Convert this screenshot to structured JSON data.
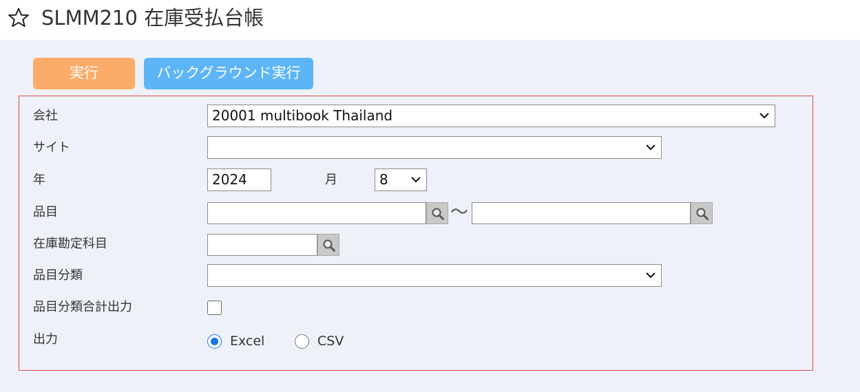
{
  "header": {
    "title": "SLMM210 在庫受払台帳",
    "favorite_icon": "star-outline-icon"
  },
  "toolbar": {
    "run_label": "実行",
    "background_run_label": "バックグラウンド実行"
  },
  "form": {
    "company": {
      "label": "会社",
      "value": "20001 multibook Thailand"
    },
    "site": {
      "label": "サイト",
      "value": ""
    },
    "year": {
      "label": "年",
      "value": "2024"
    },
    "month": {
      "label": "月",
      "value": "8"
    },
    "item": {
      "label": "品目",
      "from": "",
      "to": "",
      "separator": "〜"
    },
    "inventory_account": {
      "label": "在庫勘定科目",
      "value": ""
    },
    "item_category": {
      "label": "品目分類",
      "value": ""
    },
    "category_total": {
      "label": "品目分類合計出力",
      "checked": false
    },
    "output": {
      "label": "出力",
      "options": [
        "Excel",
        "CSV"
      ],
      "selected": "Excel"
    }
  },
  "colors": {
    "run_button": "#fdab68",
    "background_button": "#5db5f7",
    "panel_border": "#e54545",
    "radio_selected": "#1a73e8",
    "page_background": "#eef2f8"
  }
}
